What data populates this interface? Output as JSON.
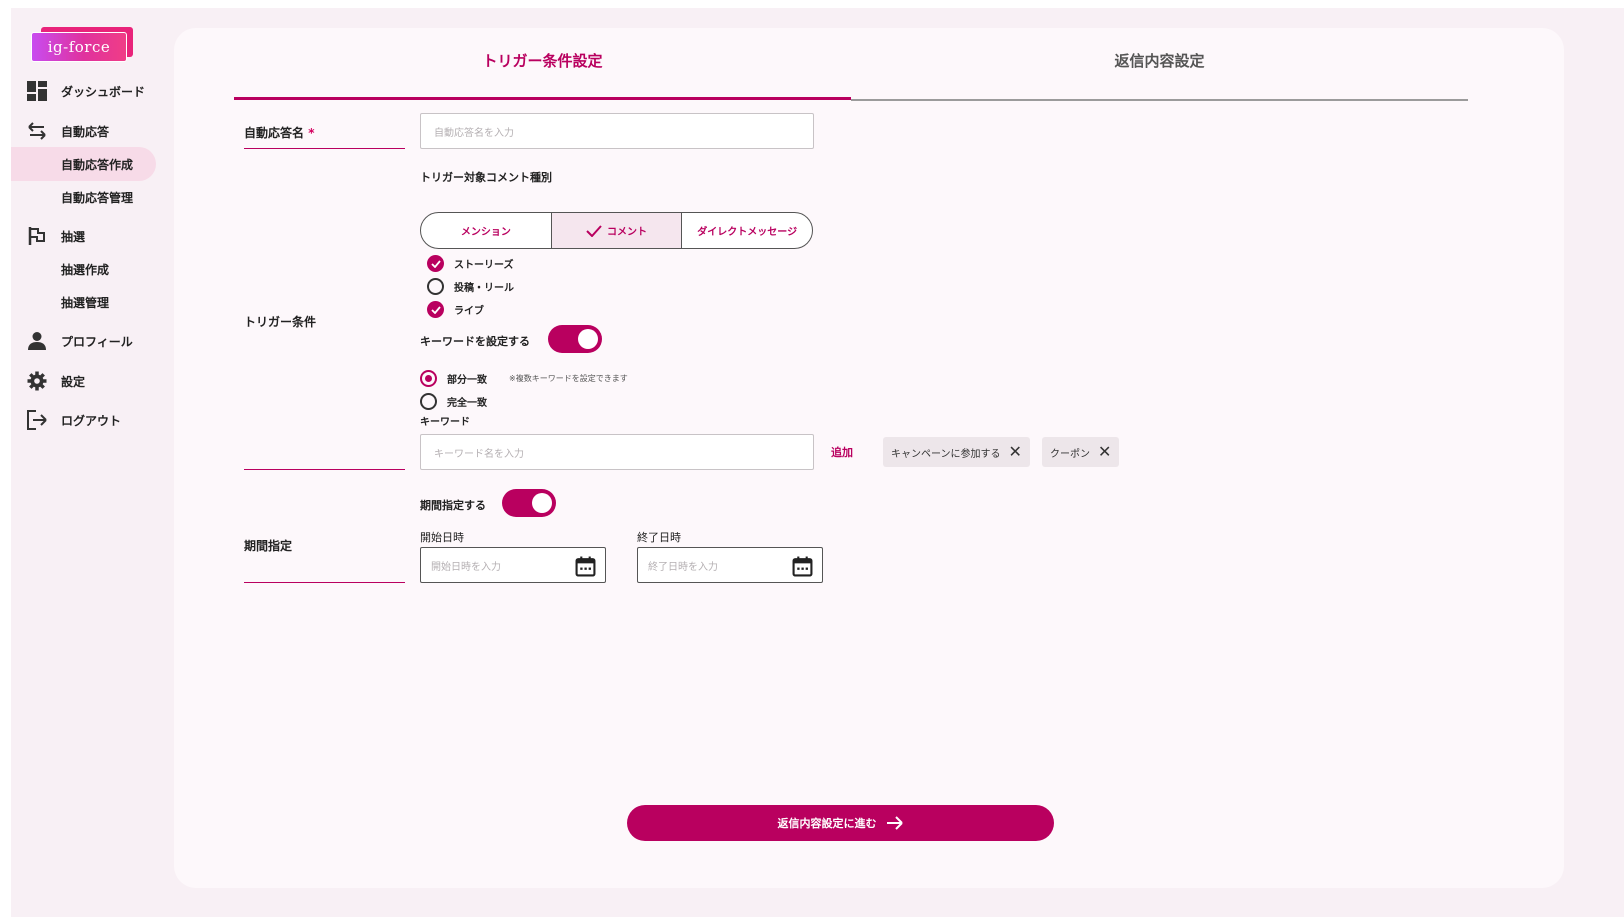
{
  "app": {
    "logo_text": "ig-force"
  },
  "sidebar": {
    "items": [
      {
        "label": "ダッシュボード",
        "icon": "dashboard-icon"
      },
      {
        "label": "自動応答",
        "icon": "swap-arrows-icon"
      },
      {
        "label": "自動応答作成",
        "sub": true,
        "active": true
      },
      {
        "label": "自動応答管理",
        "sub": true
      },
      {
        "label": "抽選",
        "icon": "flag-icon"
      },
      {
        "label": "抽選作成",
        "sub": true
      },
      {
        "label": "抽選管理",
        "sub": true
      },
      {
        "label": "プロフィール",
        "icon": "person-icon"
      },
      {
        "label": "設定",
        "icon": "gear-icon"
      },
      {
        "label": "ログアウト",
        "icon": "logout-icon"
      }
    ]
  },
  "tabs": [
    {
      "label": "トリガー条件設定",
      "active": true
    },
    {
      "label": "返信内容設定",
      "active": false
    }
  ],
  "form": {
    "name_label": "自動応答名",
    "required_mark": "*",
    "name_placeholder": "自動応答名を入力",
    "trigger_label": "トリガー条件",
    "comment_type_label": "トリガー対象コメント種別",
    "segments": [
      {
        "label": "メンション",
        "selected": false
      },
      {
        "label": "コメント",
        "selected": true
      },
      {
        "label": "ダイレクトメッセージ",
        "selected": false
      }
    ],
    "checks": [
      {
        "label": "ストーリーズ",
        "checked": true
      },
      {
        "label": "投稿・リール",
        "checked": false
      },
      {
        "label": "ライブ",
        "checked": true
      }
    ],
    "keyword_toggle_label": "キーワードを設定する",
    "keyword_toggle_on": true,
    "match_options": [
      {
        "label": "部分一致",
        "selected": true
      },
      {
        "label": "完全一致",
        "selected": false
      }
    ],
    "match_hint": "※複数キーワードを設定できます",
    "keyword_label": "キーワード",
    "keyword_placeholder": "キーワード名を入力",
    "add_label": "追加",
    "chips": [
      "キャンペーンに参加する",
      "クーポン"
    ],
    "period_label": "期間指定",
    "period_toggle_label": "期間指定する",
    "period_toggle_on": true,
    "start_label": "開始日時",
    "start_placeholder": "開始日時を入力",
    "end_label": "終了日時",
    "end_placeholder": "終了日時を入力"
  },
  "next_button": "返信内容設定に進む",
  "colors": {
    "accent": "#b9005f",
    "background": "#f8f0f5",
    "card": "#fdf8fb"
  }
}
